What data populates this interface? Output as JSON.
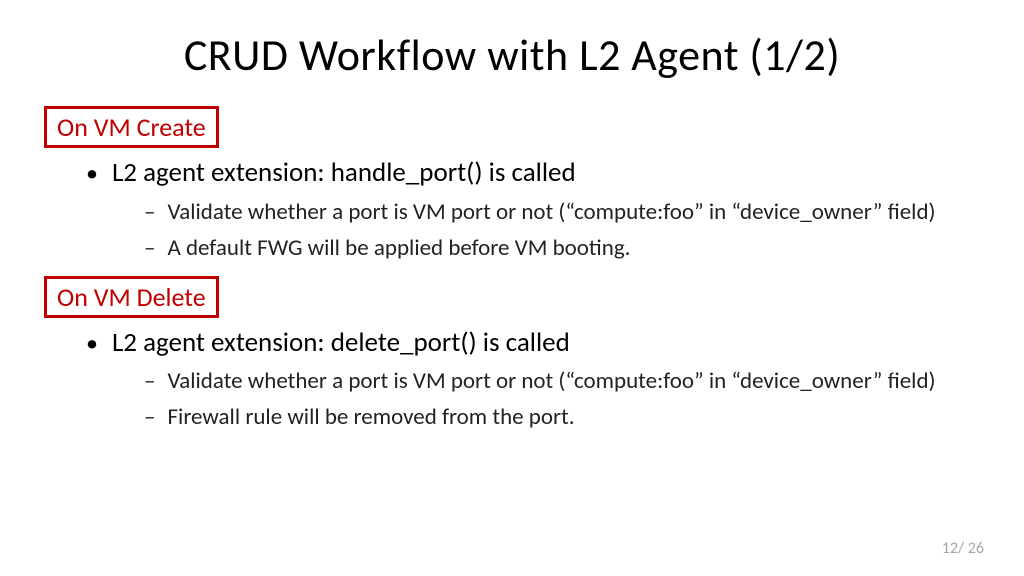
{
  "title": "CRUD Workflow with L2 Agent (1/2)",
  "sections": [
    {
      "label": "On VM Create",
      "bullets": [
        {
          "text": "L2 agent extension:  handle_port() is called",
          "sub": [
            "Validate whether a port is VM port or not (“compute:foo” in “device_owner” field)",
            "A default FWG will be applied before VM booting."
          ]
        }
      ]
    },
    {
      "label": "On VM Delete",
      "bullets": [
        {
          "text": "L2 agent extension: delete_port() is called",
          "sub": [
            "Validate whether a port is VM port or not (“compute:foo” in “device_owner” field)",
            "Firewall rule will be removed from the port."
          ]
        }
      ]
    }
  ],
  "page": {
    "current": "12",
    "total": "26",
    "sep": "/"
  }
}
